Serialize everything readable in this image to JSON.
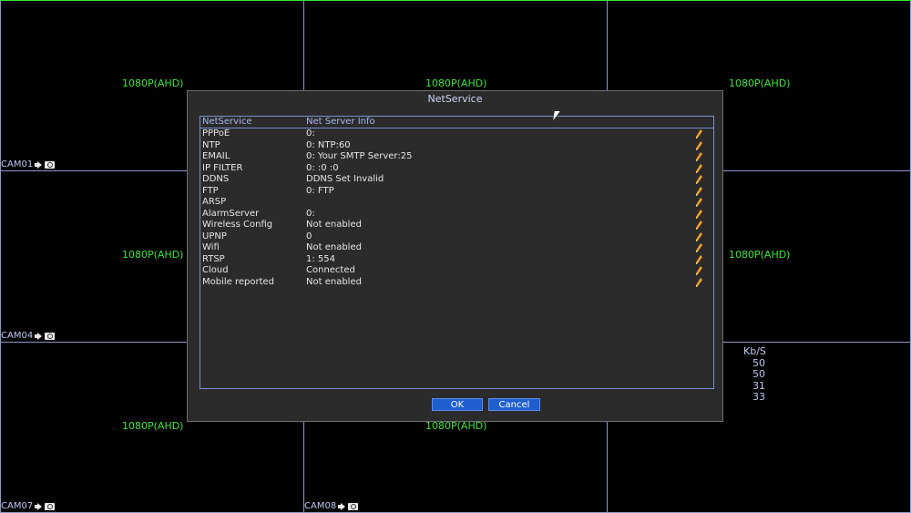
{
  "colors": {
    "grid": "#8e97c7",
    "resolution": "#3ce43c",
    "accent": "#1f5ecf"
  },
  "grid": {
    "cells": [
      {
        "res": "1080P(AHD)",
        "cam": "CAM01"
      },
      {
        "res": "1080P(AHD)",
        "cam": ""
      },
      {
        "res": "1080P(AHD)",
        "cam": ""
      },
      {
        "res": "1080P(AHD)",
        "cam": "CAM04"
      },
      {
        "res": "",
        "cam": ""
      },
      {
        "res": "1080P(AHD)",
        "cam": ""
      },
      {
        "res": "1080P(AHD)",
        "cam": "CAM07"
      },
      {
        "res": "1080P(AHD)",
        "cam": "CAM08"
      },
      {
        "res": "",
        "cam": ""
      }
    ]
  },
  "bitrate": {
    "header": "Kb/S",
    "values": [
      "50",
      "50",
      "31",
      "33"
    ]
  },
  "dialog": {
    "title": "NetService",
    "columns": {
      "service": "NetService",
      "info": "Net Server Info"
    },
    "rows": [
      {
        "service": "PPPoE",
        "info": "0:"
      },
      {
        "service": "NTP",
        "info": "0: NTP:60"
      },
      {
        "service": "EMAIL",
        "info": "0: Your SMTP Server:25"
      },
      {
        "service": "IP FILTER",
        "info": "0: :0 :0"
      },
      {
        "service": "DDNS",
        "info": "DDNS Set Invalid"
      },
      {
        "service": "FTP",
        "info": "0: FTP"
      },
      {
        "service": "ARSP",
        "info": ""
      },
      {
        "service": "AlarmServer",
        "info": "0:"
      },
      {
        "service": "Wireless Config",
        "info": "Not enabled"
      },
      {
        "service": "UPNP",
        "info": "0"
      },
      {
        "service": "Wifi",
        "info": "Not enabled"
      },
      {
        "service": "RTSP",
        "info": "1: 554"
      },
      {
        "service": "Cloud",
        "info": "Connected"
      },
      {
        "service": "Mobile reported",
        "info": "Not enabled"
      }
    ],
    "ok_label": "OK",
    "cancel_label": "Cancel"
  }
}
